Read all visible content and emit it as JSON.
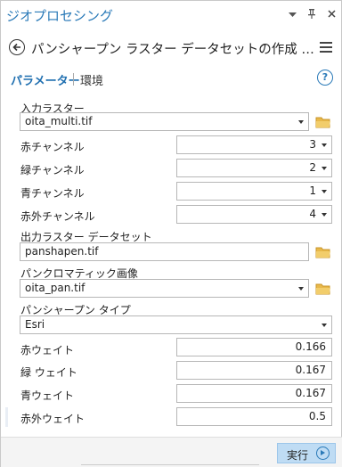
{
  "header": {
    "app_title": "ジオプロセシング",
    "icons": [
      "chevron-down-icon",
      "pin-icon",
      "close-icon"
    ]
  },
  "tool": {
    "title": "パンシャープン ラスター データセットの作成 (Create Pa..."
  },
  "tabs": {
    "parameters": "パラメーター",
    "environments": "環境"
  },
  "params": {
    "input_raster": {
      "label": "入力ラスター",
      "value": "oita_multi.tif"
    },
    "red_channel": {
      "label": "赤チャンネル",
      "value": "3"
    },
    "green_channel": {
      "label": "緑チャンネル",
      "value": "2"
    },
    "blue_channel": {
      "label": "青チャンネル",
      "value": "1"
    },
    "ir_channel": {
      "label": "赤外チャンネル",
      "value": "4"
    },
    "output_raster": {
      "label": "出力ラスター データセット",
      "value": "panshapen.tif"
    },
    "pan_image": {
      "label": "パンクロマティック画像",
      "value": "oita_pan.tif"
    },
    "pansharpen_type": {
      "label": "パンシャープン タイプ",
      "value": "Esri"
    },
    "red_weight": {
      "label": "赤ウェイト",
      "value": "0.166"
    },
    "green_weight": {
      "label": "緑 ウェイト",
      "value": "0.167"
    },
    "blue_weight": {
      "label": "青ウェイト",
      "value": "0.167"
    },
    "ir_weight": {
      "label": "赤外ウェイト",
      "value": "0.5"
    }
  },
  "footer": {
    "run_label": "実行"
  },
  "colors": {
    "accent": "#2a7ab8",
    "run_bg": "#bfdcf4",
    "folder": "#e8b84a"
  }
}
